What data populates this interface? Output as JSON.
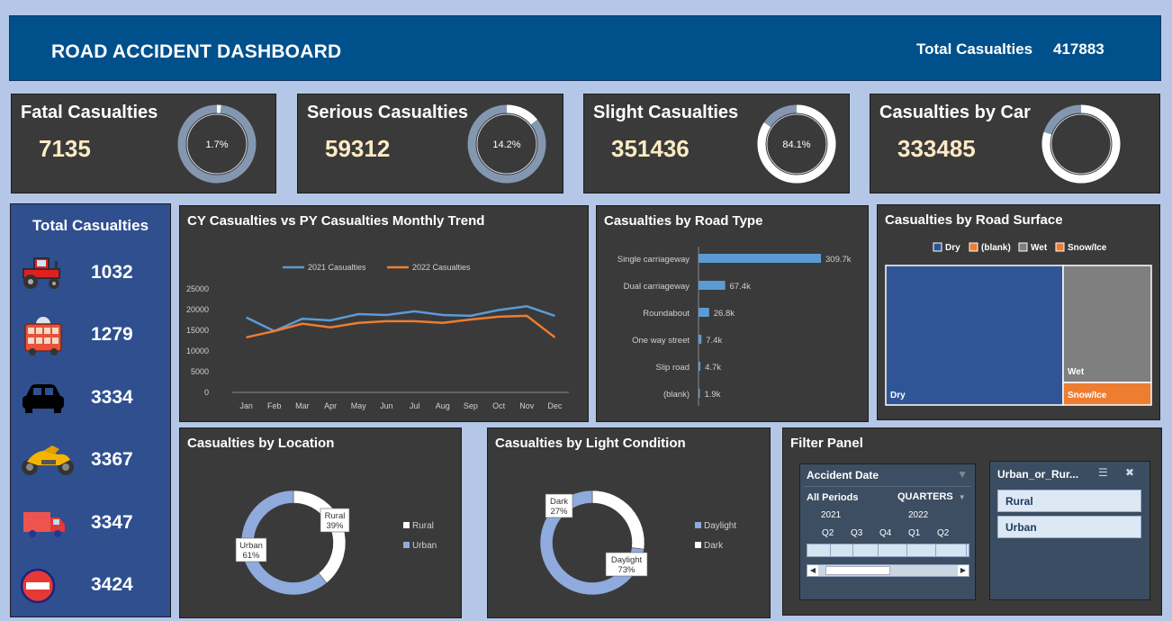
{
  "header": {
    "title": "ROAD ACCIDENT DASHBOARD",
    "total_label": "Total Casualties",
    "total_value": "417883"
  },
  "kpis": [
    {
      "title": "Fatal Casualties",
      "value": "7135",
      "pct_label": "1.7%",
      "pct": 1.7
    },
    {
      "title": "Serious Casualties",
      "value": "59312",
      "pct_label": "14.2%",
      "pct": 14.2
    },
    {
      "title": "Slight Casualties",
      "value": "351436",
      "pct_label": "84.1%",
      "pct": 84.1
    },
    {
      "title": "Casualties by Car",
      "value": "333485",
      "pct_label": "",
      "pct": 79.8
    }
  ],
  "vehicle_totals": {
    "title": "Total Casualties",
    "items": [
      {
        "icon": "tractor-icon",
        "value": "1032"
      },
      {
        "icon": "bus-icon",
        "value": "1279"
      },
      {
        "icon": "car-icon",
        "value": "3334"
      },
      {
        "icon": "motorcycle-icon",
        "value": "3367"
      },
      {
        "icon": "truck-icon",
        "value": "3347"
      },
      {
        "icon": "no-entry-icon",
        "value": "3424"
      }
    ]
  },
  "colors": {
    "blue": "#5b9bd5",
    "orange": "#ed7d31",
    "dark_blue": "#2f5597",
    "grey": "#7f7f7f",
    "light_blue": "#8faadc",
    "panel": "#3a3a3a"
  },
  "chart_data": [
    {
      "type": "line",
      "title": "CY Casualties vs PY Casualties Monthly Trend",
      "categories": [
        "Jan",
        "Feb",
        "Mar",
        "Apr",
        "May",
        "Jun",
        "Jul",
        "Aug",
        "Sep",
        "Oct",
        "Nov",
        "Dec"
      ],
      "series": [
        {
          "name": "2021 Casualties",
          "color": "#5b9bd5",
          "values": [
            18100,
            14800,
            17800,
            17400,
            18900,
            18700,
            19600,
            18700,
            18500,
            19900,
            20800,
            18500
          ]
        },
        {
          "name": "2022 Casualties",
          "color": "#ed7d31",
          "values": [
            13300,
            14800,
            16600,
            15700,
            16800,
            17200,
            17200,
            16800,
            17600,
            18300,
            18500,
            13300
          ]
        }
      ],
      "y_ticks": [
        "0",
        "5000",
        "10000",
        "15000",
        "20000",
        "25000"
      ],
      "ylim": [
        0,
        25000
      ],
      "legend": "top"
    },
    {
      "type": "bar",
      "title": "Casualties by Road Type",
      "categories": [
        "Single carriageway",
        "Dual carriageway",
        "Roundabout",
        "One way street",
        "Slip road",
        "(blank)"
      ],
      "values": [
        309.7,
        67.4,
        26.8,
        7.4,
        4.7,
        1.9
      ],
      "labels": [
        "309.7k",
        "67.4k",
        "26.8k",
        "7.4k",
        "4.7k",
        "1.9k"
      ],
      "orientation": "horizontal"
    },
    {
      "type": "treemap",
      "title": "Casualties by Road Surface",
      "legend": [
        {
          "name": "Dry",
          "color": "#2f5597"
        },
        {
          "name": "(blank)",
          "color": "#ed7d31"
        },
        {
          "name": "Wet",
          "color": "#7f7f7f"
        },
        {
          "name": "Snow/Ice",
          "color": "#ed7d31"
        }
      ],
      "labels": [
        "Dry",
        "Wet",
        "Snow/Ice"
      ]
    },
    {
      "type": "pie",
      "title": "Casualties by Location",
      "slices": [
        {
          "name": "Rural",
          "value": 39,
          "label": "Rural\n39%",
          "color": "#ffffff"
        },
        {
          "name": "Urban",
          "value": 61,
          "label": "Urban\n61%",
          "color": "#8faadc"
        }
      ],
      "legend": [
        "Rural",
        "Urban"
      ]
    },
    {
      "type": "pie",
      "title": "Casualties by Light Condition",
      "slices": [
        {
          "name": "Dark",
          "value": 27,
          "label": "Dark\n27%",
          "color": "#ffffff"
        },
        {
          "name": "Daylight",
          "value": 73,
          "label": "Daylight\n73%",
          "color": "#8faadc"
        }
      ],
      "legend": [
        "Daylight",
        "Dark"
      ]
    }
  ],
  "filter_panel": {
    "title": "Filter Panel",
    "date_slicer": {
      "title": "Accident Date",
      "all_periods": "All Periods",
      "level": "QUARTERS",
      "years": [
        "2021",
        "2022"
      ],
      "quarters": [
        "Q2",
        "Q3",
        "Q4",
        "Q1",
        "Q2"
      ]
    },
    "urban_slicer": {
      "title": "Urban_or_Rur...",
      "options": [
        "Rural",
        "Urban"
      ]
    }
  }
}
